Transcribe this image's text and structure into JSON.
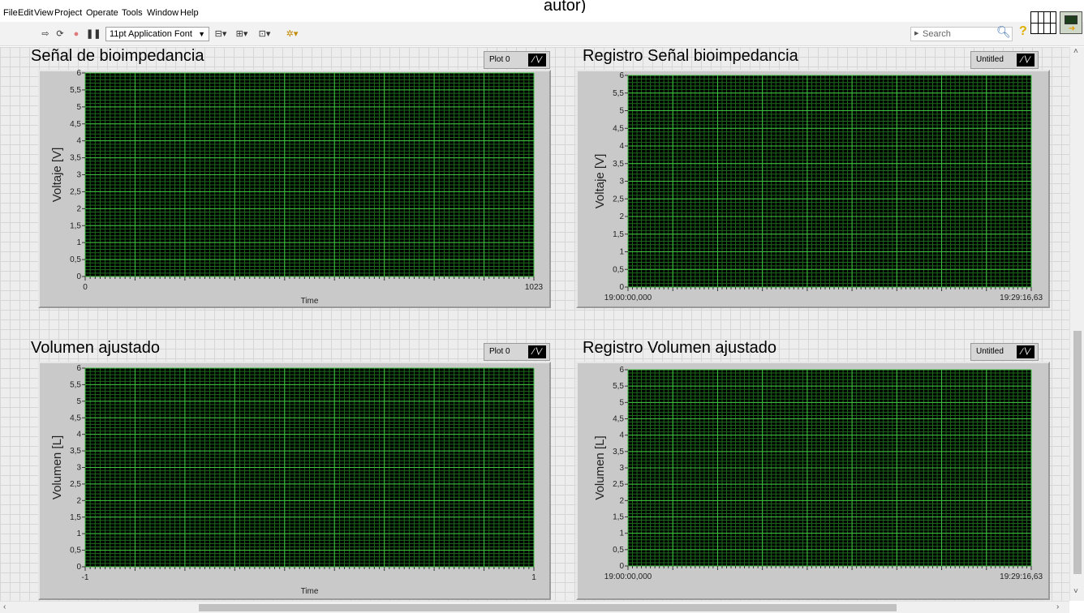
{
  "caption_fragment": "autor)",
  "menu": [
    "File",
    "Edit",
    "View",
    "Project",
    "Operate",
    "Tools",
    "Window",
    "Help"
  ],
  "toolbar": {
    "font_select": "11pt Application Font",
    "search_placeholder": "Search"
  },
  "graphs": [
    {
      "title": "Señal de bioimpedancia",
      "legend": "Plot 0",
      "ylabel": "Voltaje [V]",
      "xlabel": "Time",
      "x_ticks": [
        "0",
        "1023"
      ],
      "y_ticks": [
        "0",
        "0,5",
        "1",
        "1,5",
        "2",
        "2,5",
        "3",
        "3,5",
        "4",
        "4,5",
        "5",
        "5,5",
        "6"
      ]
    },
    {
      "title": "Registro Señal bioimpedancia",
      "legend": "Untitled",
      "ylabel": "Voltaje [V]",
      "xlabel": "",
      "x_ticks": [
        "19:00:00,000",
        "19:29:16,63"
      ],
      "y_ticks": [
        "0",
        "0,5",
        "1",
        "1,5",
        "2",
        "2,5",
        "3",
        "3,5",
        "4",
        "4,5",
        "5",
        "5,5",
        "6"
      ]
    },
    {
      "title": "Volumen ajustado",
      "legend": "Plot 0",
      "ylabel": "Volumen  [L]",
      "xlabel": "Time",
      "x_ticks": [
        "-1",
        "1"
      ],
      "y_ticks": [
        "0",
        "0,5",
        "1",
        "1,5",
        "2",
        "2,5",
        "3",
        "3,5",
        "4",
        "4,5",
        "5",
        "5,5",
        "6"
      ]
    },
    {
      "title": "Registro Volumen ajustado",
      "legend": "Untitled",
      "ylabel": "Volumen [L]",
      "xlabel": "",
      "x_ticks": [
        "19:00:00,000",
        "19:29:16,63"
      ],
      "y_ticks": [
        "0",
        "0,5",
        "1",
        "1,5",
        "2",
        "2,5",
        "3",
        "3,5",
        "4",
        "4,5",
        "5",
        "5,5",
        "6"
      ]
    }
  ],
  "chart_data": [
    {
      "type": "line",
      "title": "Señal de bioimpedancia",
      "xlabel": "Time",
      "ylabel": "Voltaje [V]",
      "xlim": [
        0,
        1023
      ],
      "ylim": [
        0,
        6
      ],
      "grid": true,
      "legend": [
        "Plot 0"
      ],
      "series": []
    },
    {
      "type": "line",
      "title": "Registro Señal bioimpedancia",
      "xlabel": "",
      "ylabel": "Voltaje [V]",
      "xlim": [
        "19:00:00,000",
        "19:29:16,63"
      ],
      "ylim": [
        0,
        6
      ],
      "grid": true,
      "legend": [
        "Untitled"
      ],
      "series": []
    },
    {
      "type": "line",
      "title": "Volumen ajustado",
      "xlabel": "Time",
      "ylabel": "Volumen  [L]",
      "xlim": [
        -1,
        1
      ],
      "ylim": [
        0,
        6
      ],
      "grid": true,
      "legend": [
        "Plot 0"
      ],
      "series": []
    },
    {
      "type": "line",
      "title": "Registro Volumen ajustado",
      "xlabel": "",
      "ylabel": "Volumen [L]",
      "xlim": [
        "19:00:00,000",
        "19:29:16,63"
      ],
      "ylim": [
        0,
        6
      ],
      "grid": true,
      "legend": [
        "Untitled"
      ],
      "series": []
    }
  ],
  "colors": {
    "plot_background": "#000000",
    "major_grid": "#3ec43e",
    "minor_grid": "#1c6a1c",
    "panel_background": "#ededed"
  }
}
